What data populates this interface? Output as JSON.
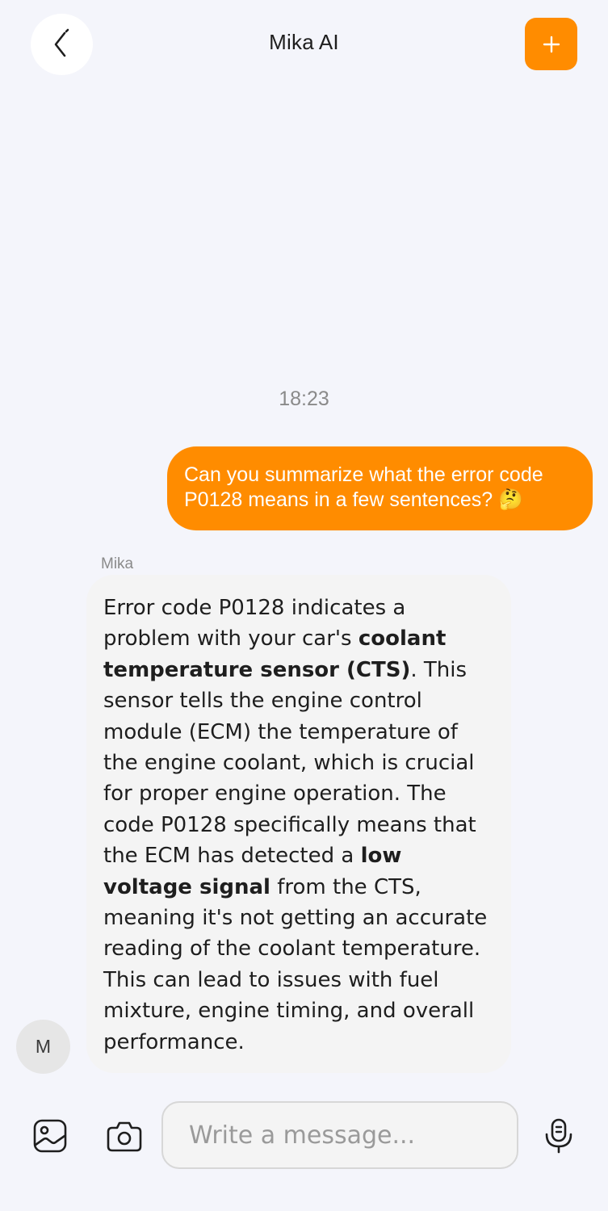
{
  "header": {
    "title": "Mika AI",
    "back_icon": "chevron-left-icon",
    "new_chat_icon": "plus-icon"
  },
  "chat": {
    "timestamp": "18:23",
    "user_message": "Can you summarize what the error code P0128 means in a few sentences? 🤔",
    "bot_sender": "Mika",
    "bot_avatar_initial": "M",
    "bot_message": {
      "part1": "Error code P0128 indicates a problem with your car's ",
      "bold1": "coolant temperature sensor (CTS)",
      "part2": ". This sensor tells the engine control module (ECM) the temperature of the engine coolant, which is crucial for proper engine operation. The code P0128 specifically means that the ECM has detected a ",
      "bold2": "low voltage signal",
      "part3": " from the CTS, meaning it's not getting an accurate reading of the coolant temperature. This can lead to issues with fuel mixture, engine timing, and overall performance."
    }
  },
  "composer": {
    "placeholder": "Write a message...",
    "value": "",
    "gallery_icon": "image-icon",
    "camera_icon": "camera-icon",
    "mic_icon": "microphone-icon"
  },
  "colors": {
    "accent": "#ff8c00",
    "background": "#f4f5fb",
    "bubble_bot": "#f4f4f4"
  }
}
